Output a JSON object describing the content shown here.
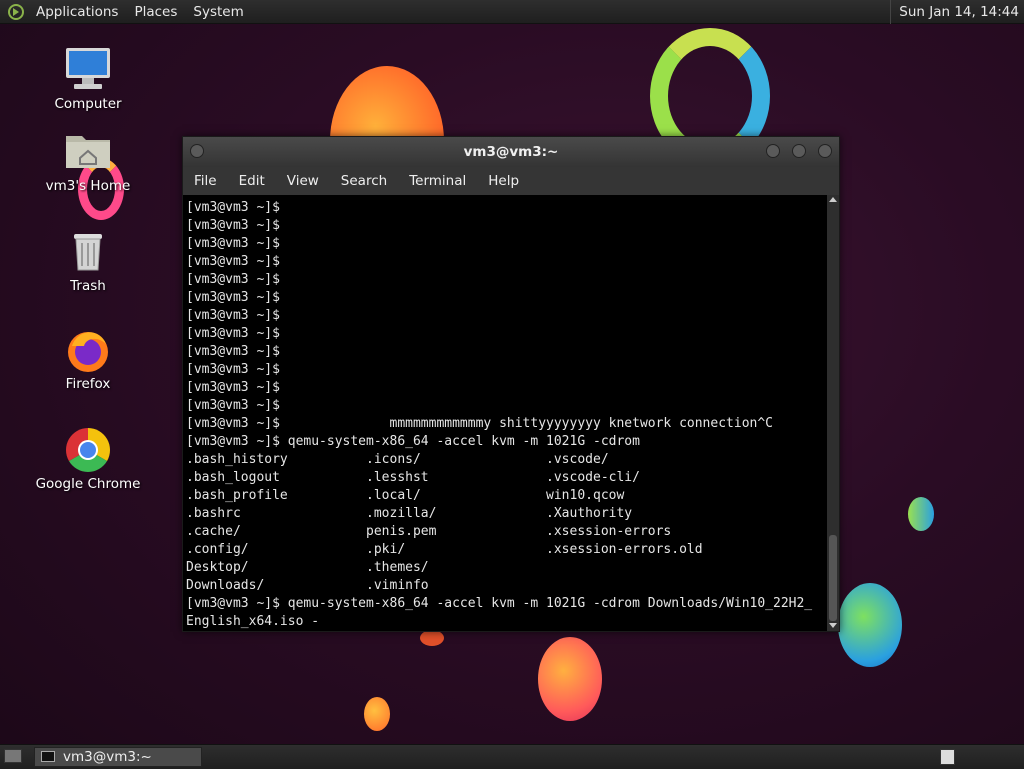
{
  "top_panel": {
    "menus": [
      "Applications",
      "Places",
      "System"
    ],
    "clock": "Sun Jan 14, 14:44"
  },
  "desktop_icons": [
    {
      "label": "Computer",
      "icon": "computer-icon"
    },
    {
      "label": "vm3's Home",
      "icon": "home-folder-icon"
    },
    {
      "label": "Trash",
      "icon": "trash-icon"
    },
    {
      "label": "Firefox",
      "icon": "firefox-icon"
    },
    {
      "label": "Google Chrome",
      "icon": "chrome-icon"
    }
  ],
  "terminal": {
    "title": "vm3@vm3:~",
    "menu": [
      "File",
      "Edit",
      "View",
      "Search",
      "Terminal",
      "Help"
    ],
    "lines": [
      "[vm3@vm3 ~]$",
      "[vm3@vm3 ~]$",
      "[vm3@vm3 ~]$",
      "[vm3@vm3 ~]$",
      "[vm3@vm3 ~]$",
      "[vm3@vm3 ~]$",
      "[vm3@vm3 ~]$",
      "[vm3@vm3 ~]$",
      "[vm3@vm3 ~]$",
      "[vm3@vm3 ~]$",
      "[vm3@vm3 ~]$",
      "[vm3@vm3 ~]$",
      "[vm3@vm3 ~]$              mmmmmmmmmmmmy shittyyyyyyyy knetwork connection^C",
      "[vm3@vm3 ~]$ qemu-system-x86_64 -accel kvm -m 1021G -cdrom",
      ".bash_history          .icons/                .vscode/",
      ".bash_logout           .lesshst               .vscode-cli/",
      ".bash_profile          .local/                win10.qcow",
      ".bashrc                .mozilla/              .Xauthority",
      ".cache/                penis.pem              .xsession-errors",
      ".config/               .pki/                  .xsession-errors.old",
      "Desktop/               .themes/",
      "Downloads/             .viminfo",
      "[vm3@vm3 ~]$ qemu-system-x86_64 -accel kvm -m 1021G -cdrom Downloads/Win10_22H2_",
      "English_x64.iso -"
    ]
  },
  "taskbar": {
    "window_button": "vm3@vm3:~"
  },
  "colors": {
    "background": "#2a0c24",
    "panel": "#252525",
    "terminal_bg": "#000000",
    "terminal_fg": "#e6e6e6"
  }
}
